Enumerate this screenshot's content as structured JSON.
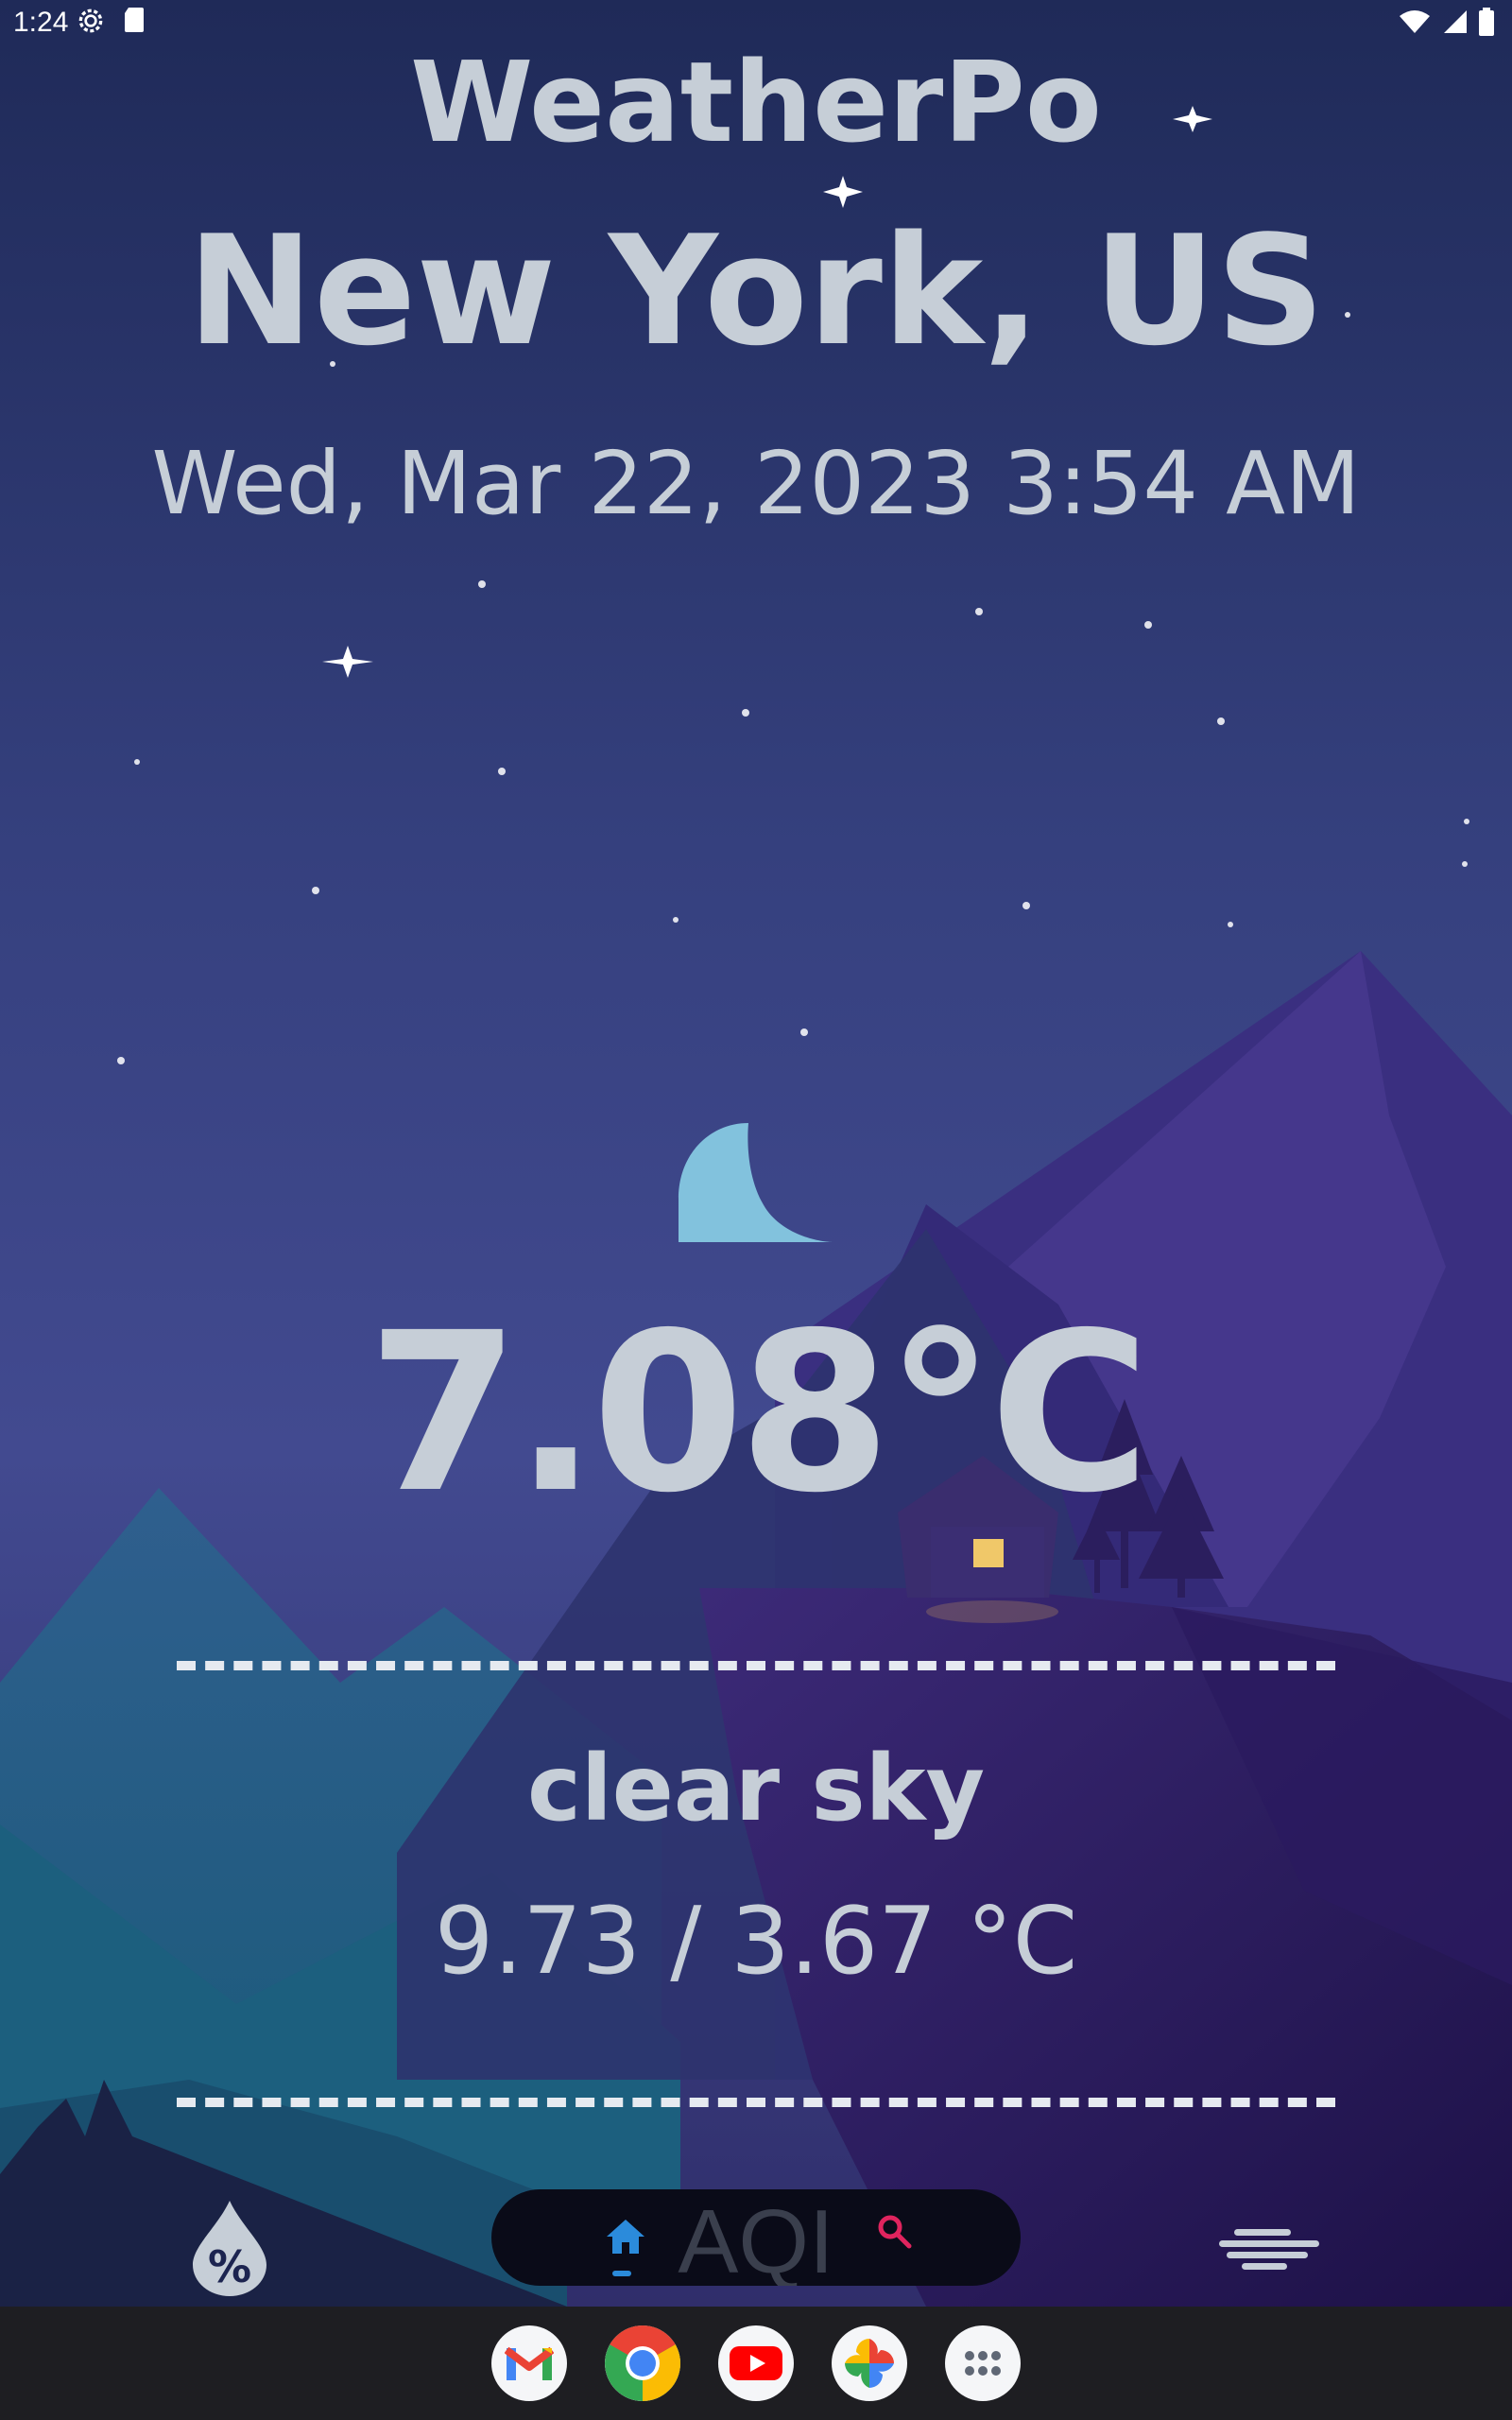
{
  "status_bar": {
    "time": "1:24"
  },
  "header": {
    "app_title": "WeatherPo",
    "city": "New York, US",
    "datetime": "Wed, Mar 22, 2023 3:54 AM"
  },
  "weather": {
    "condition_icon": "moon-icon",
    "temperature": "7.08°C",
    "description": "clear sky",
    "range": "9.73 / 3.67 °C"
  },
  "bottom_nav": {
    "left_icon": "humidity-percent-icon",
    "center_label": "AQI",
    "right_icon": "wind-icon",
    "home_icon": "home-icon",
    "search_icon": "search-icon",
    "accent_color": "#2b8bdb",
    "search_color": "#e0245e"
  },
  "dock": {
    "apps": [
      "gmail",
      "chrome",
      "youtube",
      "photos",
      "app-drawer"
    ]
  },
  "colors": {
    "text": "#c6ced7",
    "sky_top": "#1f2a58",
    "sky_bottom": "#42488e",
    "moon": "#82c2dd"
  }
}
